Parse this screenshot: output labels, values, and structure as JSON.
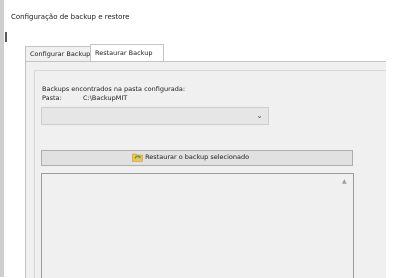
{
  "window": {
    "title": "Configuração de backup e restore"
  },
  "tabs": [
    {
      "label": "Configurar Backup",
      "active": false
    },
    {
      "label": "Restaurar Backup",
      "active": true
    }
  ],
  "restore_panel": {
    "found_label": "Backups encontrados na pasta configurada:",
    "folder_label": "Pasta:",
    "folder_path": "C:\\BackupMIT",
    "combo_selected": "",
    "restore_button_label": "Restaurar o backup selecionado",
    "restore_button_icon": "folder-restore-icon",
    "list_items": []
  },
  "colors": {
    "panel_bg": "#f0f0f0",
    "button_bg": "#e1e1e1",
    "folder_icon_yellow": "#f2c14e",
    "arrow_green": "#3aa655"
  }
}
